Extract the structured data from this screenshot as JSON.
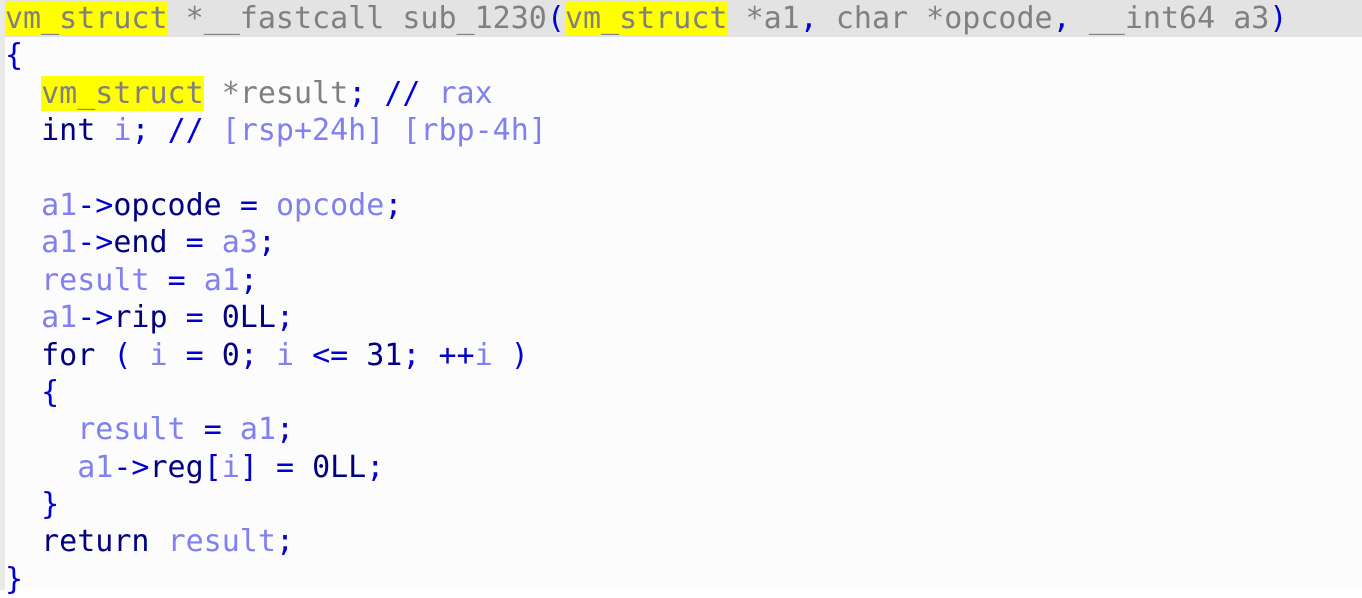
{
  "app": {
    "view_name": "hex-rays-pseudocode",
    "window_title": "Pseudocode-A"
  },
  "theme": {
    "background": "#fcfcfc",
    "gutter": "#e9e9ea",
    "current_line_background": "#e3e3e3",
    "highlight": "#ffff00",
    "punctuation": "#0000d0",
    "keyword": "#000080",
    "type": "#808080",
    "variable": "#8080f0",
    "number": "#000080",
    "comment": "#8080f0",
    "comment_marker": "#0000e0"
  },
  "code": {
    "function_name": "sub_1230",
    "highlighted_token": "vm_struct",
    "full_text": "vm_struct *__fastcall sub_1230(vm_struct *a1, char *opcode, __int64 a3)\n{\n  vm_struct *result; // rax\n  int i; // [rsp+24h] [rbp-4h]\n\n  a1->opcode = opcode;\n  a1->end = a3;\n  result = a1;\n  a1->rip = 0LL;\n  for ( i = 0; i <= 31; ++i )\n  {\n    result = a1;\n    a1->reg[i] = 0LL;\n  }\n  return result;\n}",
    "lines": [
      {
        "index": 0,
        "row_highlight": true,
        "indent": 0,
        "tokens": [
          {
            "t": "vm_struct",
            "c": "tok-type tok-highlight"
          },
          {
            "t": " ",
            "c": "tok-plain"
          },
          {
            "t": "*__fastcall",
            "c": "tok-type"
          },
          {
            "t": " ",
            "c": "tok-plain"
          },
          {
            "t": "sub_1230",
            "c": "tok-funcname"
          },
          {
            "t": "(",
            "c": "tok-punct"
          },
          {
            "t": "vm_struct",
            "c": "tok-type tok-highlight"
          },
          {
            "t": " ",
            "c": "tok-plain"
          },
          {
            "t": "*a1",
            "c": "tok-type"
          },
          {
            "t": ",",
            "c": "tok-punct"
          },
          {
            "t": " ",
            "c": "tok-plain"
          },
          {
            "t": "char *opcode",
            "c": "tok-type"
          },
          {
            "t": ",",
            "c": "tok-punct"
          },
          {
            "t": " ",
            "c": "tok-plain"
          },
          {
            "t": "__int64 a3",
            "c": "tok-type"
          },
          {
            "t": ")",
            "c": "tok-punct"
          }
        ]
      },
      {
        "index": 1,
        "row_highlight": false,
        "indent": 0,
        "tokens": [
          {
            "t": "{",
            "c": "tok-punct"
          }
        ]
      },
      {
        "index": 2,
        "row_highlight": false,
        "indent": 0,
        "tokens": [
          {
            "t": "  ",
            "c": "tok-plain"
          },
          {
            "t": "vm_struct",
            "c": "tok-type tok-highlight"
          },
          {
            "t": " ",
            "c": "tok-plain"
          },
          {
            "t": "*result",
            "c": "tok-type"
          },
          {
            "t": ";",
            "c": "tok-punct"
          },
          {
            "t": " ",
            "c": "tok-plain"
          },
          {
            "t": "//",
            "c": "tok-commark"
          },
          {
            "t": " rax",
            "c": "tok-comment"
          }
        ]
      },
      {
        "index": 3,
        "row_highlight": false,
        "indent": 0,
        "tokens": [
          {
            "t": "  ",
            "c": "tok-plain"
          },
          {
            "t": "int",
            "c": "tok-keyword"
          },
          {
            "t": " ",
            "c": "tok-plain"
          },
          {
            "t": "i",
            "c": "tok-var"
          },
          {
            "t": ";",
            "c": "tok-punct"
          },
          {
            "t": " ",
            "c": "tok-plain"
          },
          {
            "t": "//",
            "c": "tok-commark"
          },
          {
            "t": " [rsp+24h] [rbp-4h]",
            "c": "tok-comment"
          }
        ]
      },
      {
        "index": 4,
        "row_highlight": false,
        "indent": 0,
        "tokens": []
      },
      {
        "index": 5,
        "row_highlight": false,
        "indent": 0,
        "tokens": [
          {
            "t": "  ",
            "c": "tok-plain"
          },
          {
            "t": "a1",
            "c": "tok-var"
          },
          {
            "t": "->",
            "c": "tok-punct"
          },
          {
            "t": "opcode",
            "c": "tok-member"
          },
          {
            "t": " ",
            "c": "tok-plain"
          },
          {
            "t": "=",
            "c": "tok-punct"
          },
          {
            "t": " ",
            "c": "tok-plain"
          },
          {
            "t": "opcode",
            "c": "tok-var"
          },
          {
            "t": ";",
            "c": "tok-punct"
          }
        ]
      },
      {
        "index": 6,
        "row_highlight": false,
        "indent": 0,
        "tokens": [
          {
            "t": "  ",
            "c": "tok-plain"
          },
          {
            "t": "a1",
            "c": "tok-var"
          },
          {
            "t": "->",
            "c": "tok-punct"
          },
          {
            "t": "end",
            "c": "tok-member"
          },
          {
            "t": " ",
            "c": "tok-plain"
          },
          {
            "t": "=",
            "c": "tok-punct"
          },
          {
            "t": " ",
            "c": "tok-plain"
          },
          {
            "t": "a3",
            "c": "tok-var"
          },
          {
            "t": ";",
            "c": "tok-punct"
          }
        ]
      },
      {
        "index": 7,
        "row_highlight": false,
        "indent": 0,
        "tokens": [
          {
            "t": "  ",
            "c": "tok-plain"
          },
          {
            "t": "result",
            "c": "tok-var"
          },
          {
            "t": " ",
            "c": "tok-plain"
          },
          {
            "t": "=",
            "c": "tok-punct"
          },
          {
            "t": " ",
            "c": "tok-plain"
          },
          {
            "t": "a1",
            "c": "tok-var"
          },
          {
            "t": ";",
            "c": "tok-punct"
          }
        ]
      },
      {
        "index": 8,
        "row_highlight": false,
        "indent": 0,
        "tokens": [
          {
            "t": "  ",
            "c": "tok-plain"
          },
          {
            "t": "a1",
            "c": "tok-var"
          },
          {
            "t": "->",
            "c": "tok-punct"
          },
          {
            "t": "rip",
            "c": "tok-member"
          },
          {
            "t": " ",
            "c": "tok-plain"
          },
          {
            "t": "=",
            "c": "tok-punct"
          },
          {
            "t": " ",
            "c": "tok-plain"
          },
          {
            "t": "0LL",
            "c": "tok-number"
          },
          {
            "t": ";",
            "c": "tok-punct"
          }
        ]
      },
      {
        "index": 9,
        "row_highlight": false,
        "indent": 0,
        "tokens": [
          {
            "t": "  ",
            "c": "tok-plain"
          },
          {
            "t": "for",
            "c": "tok-keyword"
          },
          {
            "t": " ",
            "c": "tok-plain"
          },
          {
            "t": "(",
            "c": "tok-punct"
          },
          {
            "t": " ",
            "c": "tok-plain"
          },
          {
            "t": "i",
            "c": "tok-var"
          },
          {
            "t": " ",
            "c": "tok-plain"
          },
          {
            "t": "=",
            "c": "tok-punct"
          },
          {
            "t": " ",
            "c": "tok-plain"
          },
          {
            "t": "0",
            "c": "tok-number"
          },
          {
            "t": ";",
            "c": "tok-punct"
          },
          {
            "t": " ",
            "c": "tok-plain"
          },
          {
            "t": "i",
            "c": "tok-var"
          },
          {
            "t": " ",
            "c": "tok-plain"
          },
          {
            "t": "<=",
            "c": "tok-punct"
          },
          {
            "t": " ",
            "c": "tok-plain"
          },
          {
            "t": "31",
            "c": "tok-number"
          },
          {
            "t": ";",
            "c": "tok-punct"
          },
          {
            "t": " ",
            "c": "tok-plain"
          },
          {
            "t": "++",
            "c": "tok-punct"
          },
          {
            "t": "i",
            "c": "tok-var"
          },
          {
            "t": " ",
            "c": "tok-plain"
          },
          {
            "t": ")",
            "c": "tok-punct"
          }
        ]
      },
      {
        "index": 10,
        "row_highlight": false,
        "indent": 0,
        "tokens": [
          {
            "t": "  ",
            "c": "tok-plain"
          },
          {
            "t": "{",
            "c": "tok-punct"
          }
        ]
      },
      {
        "index": 11,
        "row_highlight": false,
        "indent": 0,
        "tokens": [
          {
            "t": "    ",
            "c": "tok-plain"
          },
          {
            "t": "result",
            "c": "tok-var"
          },
          {
            "t": " ",
            "c": "tok-plain"
          },
          {
            "t": "=",
            "c": "tok-punct"
          },
          {
            "t": " ",
            "c": "tok-plain"
          },
          {
            "t": "a1",
            "c": "tok-var"
          },
          {
            "t": ";",
            "c": "tok-punct"
          }
        ]
      },
      {
        "index": 12,
        "row_highlight": false,
        "indent": 0,
        "tokens": [
          {
            "t": "    ",
            "c": "tok-plain"
          },
          {
            "t": "a1",
            "c": "tok-var"
          },
          {
            "t": "->",
            "c": "tok-punct"
          },
          {
            "t": "reg",
            "c": "tok-member"
          },
          {
            "t": "[",
            "c": "tok-punct"
          },
          {
            "t": "i",
            "c": "tok-var"
          },
          {
            "t": "]",
            "c": "tok-punct"
          },
          {
            "t": " ",
            "c": "tok-plain"
          },
          {
            "t": "=",
            "c": "tok-punct"
          },
          {
            "t": " ",
            "c": "tok-plain"
          },
          {
            "t": "0LL",
            "c": "tok-number"
          },
          {
            "t": ";",
            "c": "tok-punct"
          }
        ]
      },
      {
        "index": 13,
        "row_highlight": false,
        "indent": 0,
        "tokens": [
          {
            "t": "  ",
            "c": "tok-plain"
          },
          {
            "t": "}",
            "c": "tok-punct"
          }
        ]
      },
      {
        "index": 14,
        "row_highlight": false,
        "indent": 0,
        "tokens": [
          {
            "t": "  ",
            "c": "tok-plain"
          },
          {
            "t": "return",
            "c": "tok-keyword"
          },
          {
            "t": " ",
            "c": "tok-plain"
          },
          {
            "t": "result",
            "c": "tok-var"
          },
          {
            "t": ";",
            "c": "tok-punct"
          }
        ]
      },
      {
        "index": 15,
        "row_highlight": false,
        "indent": 0,
        "tokens": [
          {
            "t": "}",
            "c": "tok-punct"
          }
        ]
      }
    ]
  }
}
